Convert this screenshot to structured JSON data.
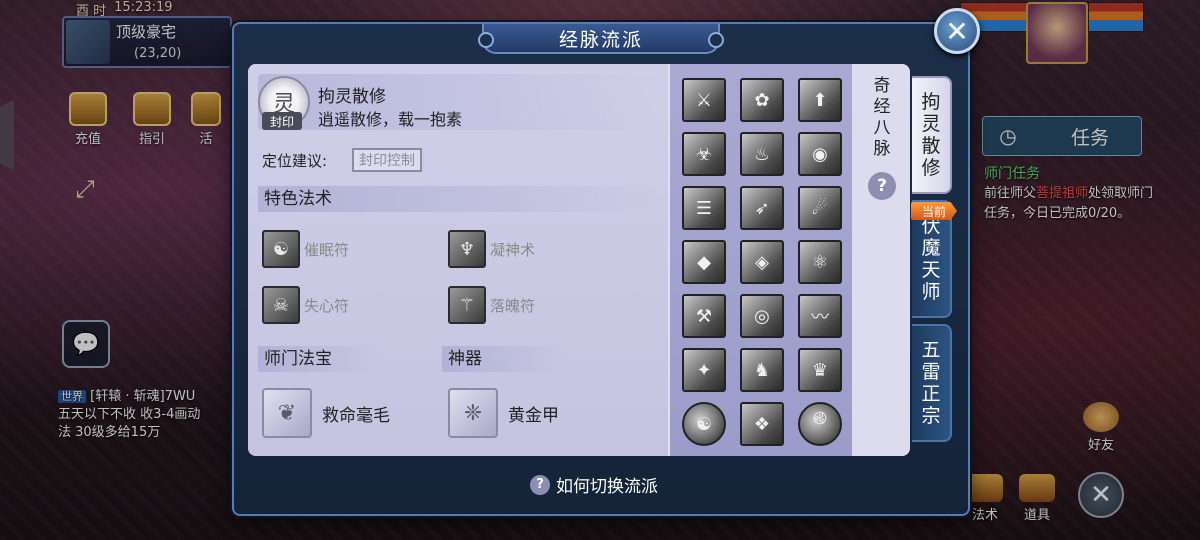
{
  "hud": {
    "time_label": "酉 时",
    "time_value": "15:23:19",
    "location_name": "顶级豪宅",
    "location_coords": "(23,20)",
    "recharge_label": "充值",
    "guide_label": "指引",
    "activity_label": "活"
  },
  "chat": {
    "channel": "世界",
    "line1": "[轩辕 · 斩魂]7WU",
    "line2": "五天以下不收 收3-4画动",
    "line3": "法  30级多给15万"
  },
  "right_hud": {
    "task_label": "任务",
    "quest_title": "师门任务",
    "quest_desc_pre": "前往师父",
    "quest_desc_highlight": "菩提祖师",
    "quest_desc_post": "处领取师门任务，今日已完成0/20。",
    "friend_label": "好友",
    "skill_label": "法术",
    "item_label": "道具"
  },
  "panel": {
    "title": "经脉流派",
    "school": {
      "icon_glyph": "灵",
      "seal_label": "封印",
      "name": "拘灵散修",
      "motto": "逍遥散修，载一抱素"
    },
    "position_label": "定位建议:",
    "position_tag": "封印控制",
    "skills_section": "特色法术",
    "skills": [
      {
        "name": "催眠符",
        "icon": "sleep-talisman"
      },
      {
        "name": "凝神术",
        "icon": "focus-spell"
      },
      {
        "name": "失心符",
        "icon": "confusion-talisman"
      },
      {
        "name": "落魄符",
        "icon": "soul-talisman"
      }
    ],
    "treasure_section": "师门法宝",
    "artifact_section": "神器",
    "treasure": {
      "name": "救命毫毛",
      "icon": "feather-icon"
    },
    "artifact": {
      "name": "黄金甲",
      "icon": "armor-icon"
    },
    "meridian_title": "奇经八脉",
    "help_glyph": "?",
    "tabs": [
      {
        "label": "拘灵散修",
        "active": true
      },
      {
        "label": "伏魔天师",
        "active": false
      },
      {
        "label": "五雷正宗",
        "active": false
      }
    ],
    "current_badge": "当前",
    "switch_hint": "如何切换流派",
    "close_glyph": "✕"
  }
}
